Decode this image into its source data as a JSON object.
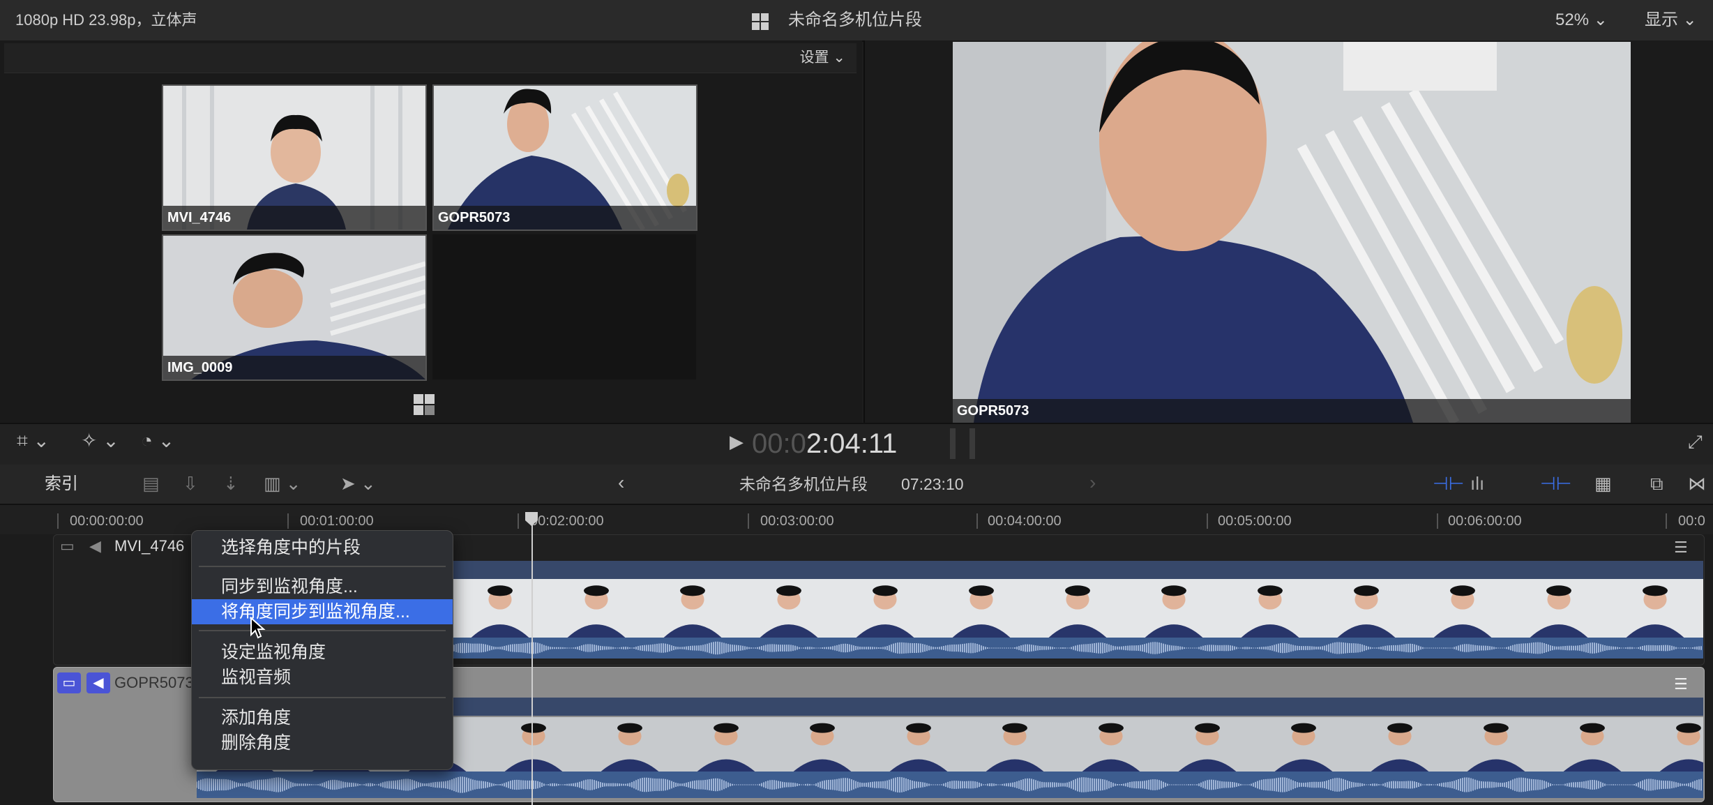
{
  "topbar": {
    "format": "1080p HD 23.98p，立体声",
    "title": "未命名多机位片段",
    "zoom": "52%",
    "display": "显示"
  },
  "angle_viewer": {
    "settings": "设置",
    "angles": [
      {
        "label": "MVI_4746"
      },
      {
        "label": "GOPR5073"
      },
      {
        "label": "IMG_0009"
      }
    ]
  },
  "viewer": {
    "label": "GOPR5073"
  },
  "playback": {
    "timecode_dim": "00:0",
    "timecode": "2:04:11"
  },
  "timeline_header": {
    "index": "索引",
    "title": "未命名多机位片段",
    "duration": "07:23:10"
  },
  "ruler": {
    "marks": [
      "00:00:00:00",
      "00:01:00:00",
      "00:02:00:00",
      "00:03:00:00",
      "00:04:00:00",
      "00:05:00:00",
      "00:06:00:00",
      "00:0"
    ]
  },
  "tracks": [
    {
      "name": "MVI_4746"
    },
    {
      "name": "GOPR5073"
    }
  ],
  "context_menu": {
    "items": [
      "选择角度中的片段",
      "同步到监视角度...",
      "将角度同步到监视角度...",
      "设定监视角度",
      "监视音频",
      "添加角度",
      "删除角度"
    ]
  },
  "colors": {
    "accent": "#3b6ee6",
    "audio_wave": "#4a6c9e",
    "track_bg_active": "#8c8c8c"
  }
}
